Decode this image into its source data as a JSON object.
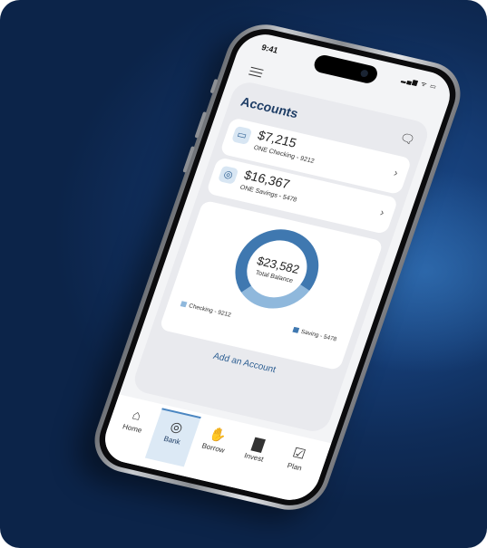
{
  "status": {
    "time": "9:41",
    "icons": "▂▄▆ ᯤ ▭"
  },
  "accounts_screen": {
    "title": "Accounts",
    "accounts": [
      {
        "amount": "$7,215",
        "name": "ONE Checking - 9212",
        "icon": "card-icon"
      },
      {
        "amount": "$16,367",
        "name": "ONE Savings - 5478",
        "icon": "piggy-bank-icon"
      }
    ],
    "total": {
      "amount": "$23,582",
      "label": "Total Balance"
    },
    "legend": [
      {
        "label": "Checking - 9212",
        "color": "#8fb8dc"
      },
      {
        "label": "Saving - 5478",
        "color": "#3f78b0"
      }
    ],
    "add_account": "Add an Account"
  },
  "tabs": [
    {
      "label": "Home",
      "icon": "home-icon",
      "active": false
    },
    {
      "label": "Bank",
      "icon": "piggy-bank-icon",
      "active": true
    },
    {
      "label": "Borrow",
      "icon": "hand-money-icon",
      "active": false
    },
    {
      "label": "Invest",
      "icon": "bar-chart-icon",
      "active": false
    },
    {
      "label": "Plan",
      "icon": "clipboard-icon",
      "active": false
    }
  ],
  "colors": {
    "background": "#153c74",
    "accent": "#2b5d91",
    "checking": "#8fb8dc",
    "saving": "#3f78b0"
  },
  "chart_data": {
    "type": "pie",
    "categories": [
      "Checking - 9212",
      "Saving - 5478"
    ],
    "values": [
      7215,
      16367
    ]
  }
}
